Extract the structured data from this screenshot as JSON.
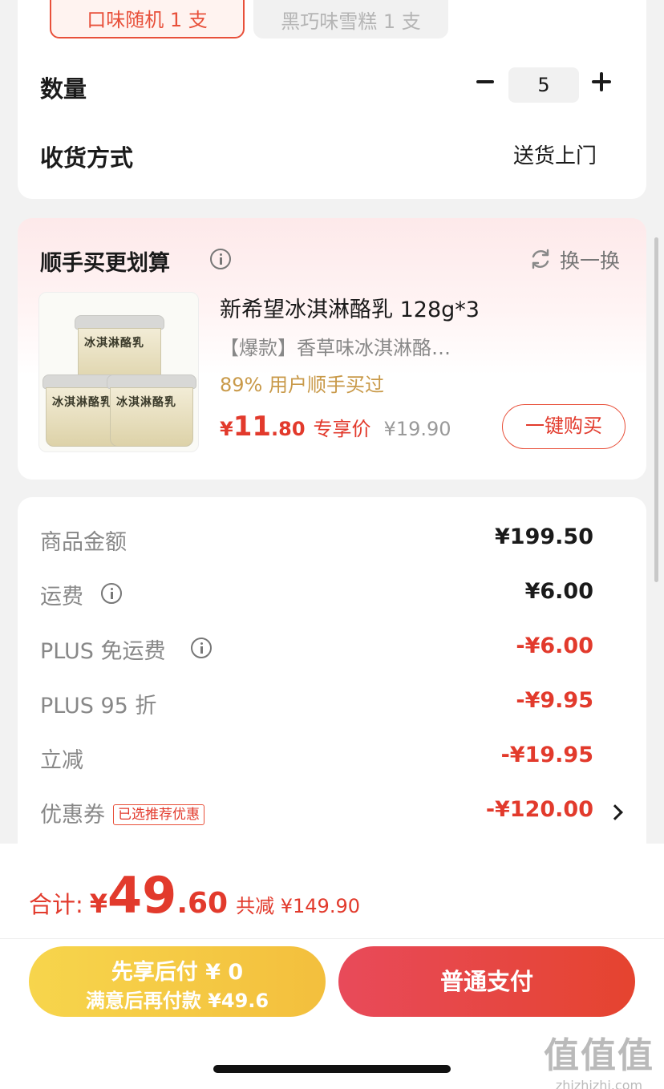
{
  "options": {
    "selected_label": "口味随机 1 支",
    "other_label": "黑巧味雪糕 1 支"
  },
  "quantity": {
    "label": "数量",
    "value": "5"
  },
  "delivery": {
    "label": "收货方式",
    "value": "送货上门"
  },
  "recommend": {
    "title": "顺手买更划算",
    "refresh_label": "换一换",
    "product": {
      "image_text": "冰淇淋酪乳",
      "name": "新希望冰淇淋酪乳 128g*3",
      "desc": "【爆款】香草味冰淇淋酪…",
      "stat": "89% 用户顺手买过",
      "price_symbol": "¥",
      "price_int": "11",
      "price_dec": ".80",
      "price_tag": "专享价",
      "original_price": "¥19.90",
      "buy_label": "一键购买"
    }
  },
  "summary": {
    "rows": [
      {
        "label": "商品金额",
        "value": "¥199.50"
      },
      {
        "label": "运费",
        "value": "¥6.00"
      },
      {
        "label": "PLUS 免运费",
        "value": "-¥6.00"
      },
      {
        "label": "PLUS 95 折",
        "value": "-¥9.95"
      },
      {
        "label": "立减",
        "value": "-¥19.95"
      },
      {
        "label": "优惠券",
        "tag": "已选推荐优惠",
        "value": "-¥120.00"
      }
    ]
  },
  "footer": {
    "total_label": "合计:",
    "total_symbol": "¥",
    "total_int": "49",
    "total_dec": ".60",
    "total_save": "共减 ¥149.90",
    "paylater_line1": "先享后付 ¥ 0",
    "paylater_line2": "满意后再付款 ¥49.6",
    "pay_label": "普通支付"
  },
  "watermark": {
    "logo": "值值值",
    "url": "zhizhizhi.com"
  },
  "colors": {
    "accent_red": "#e23a2c",
    "gold": "#f3bf3d",
    "muted": "#888888"
  }
}
